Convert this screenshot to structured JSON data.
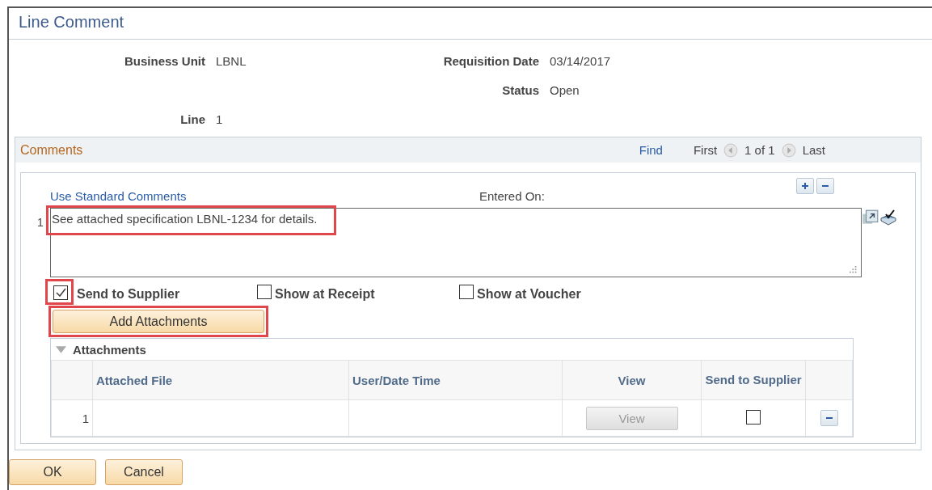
{
  "window": {
    "title": "Line Comment"
  },
  "header_rows": [
    {
      "left": {
        "label": "Business Unit",
        "value": "LBNL"
      },
      "right": {
        "label": "Requisition Date",
        "value": "03/14/2017"
      }
    },
    {
      "right": {
        "label": "Status",
        "value": "Open"
      }
    },
    {
      "left": {
        "label": "Line",
        "value": "1"
      }
    }
  ],
  "comments": {
    "title": "Comments",
    "nav": {
      "find": "Find",
      "first": "First",
      "count": "1 of 1",
      "last": "Last"
    },
    "link": "Use Standard Comments",
    "entered_on_label": "Entered On:",
    "row_number": "1",
    "text": "See attached specification LBNL-1234 for details.",
    "text_highlighted": true,
    "options": [
      {
        "label": "Send to Supplier",
        "checked": true,
        "highlighted": true
      },
      {
        "label": "Show at Receipt",
        "checked": false,
        "highlighted": false
      },
      {
        "label": "Show at Voucher",
        "checked": false,
        "highlighted": false
      }
    ],
    "add_button": {
      "label": "Add Attachments",
      "highlighted": true
    },
    "attachments": {
      "title": "Attachments",
      "expanded": true,
      "columns": [
        "Attached File",
        "User/Date Time",
        "View",
        "Send to Supplier"
      ],
      "rows": [
        {
          "number": "1",
          "view_button": "View",
          "view_disabled": true,
          "send_to_supplier": false
        }
      ]
    }
  },
  "buttons": [
    "OK",
    "Cancel"
  ]
}
